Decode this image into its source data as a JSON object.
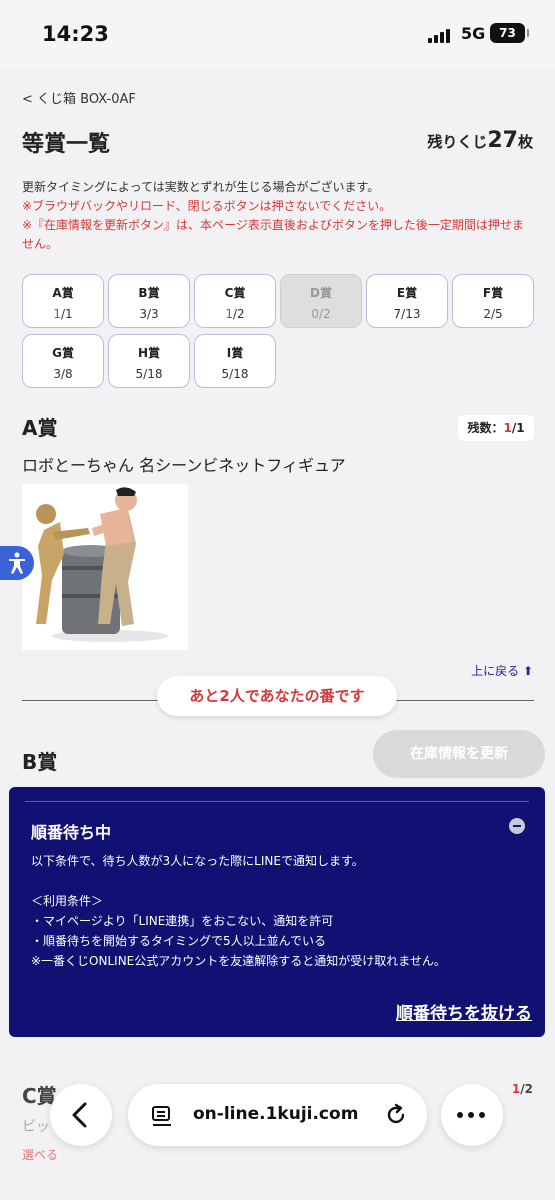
{
  "status": {
    "time": "14:23",
    "network": "5G",
    "battery": "73"
  },
  "breadcrumb": "くじ箱 BOX-0AF",
  "header": {
    "title": "等賞一覧",
    "remaining_label": "残りくじ",
    "remaining_count": "27",
    "remaining_unit": "枚"
  },
  "notes": {
    "line1": "更新タイミングによっては実数とずれが生じる場合がございます。",
    "line2": "※ブラウザバックやリロード、閉じるボタンは押さないでください。",
    "line3": "※『在庫情報を更新ボタン』は、本ページ表示直後およびボタンを押した後一定期間は押せません。"
  },
  "prizes": [
    {
      "name": "A賞",
      "left": "1",
      "total": "/1",
      "highlight": true,
      "disabled": false
    },
    {
      "name": "B賞",
      "left": "3",
      "total": "/3",
      "highlight": false,
      "disabled": false
    },
    {
      "name": "C賞",
      "left": "1",
      "total": "/2",
      "highlight": true,
      "disabled": false
    },
    {
      "name": "D賞",
      "left": "0",
      "total": "/2",
      "highlight": false,
      "disabled": true
    },
    {
      "name": "E賞",
      "left": "7",
      "total": "/13",
      "highlight": false,
      "disabled": false
    },
    {
      "name": "F賞",
      "left": "2",
      "total": "/5",
      "highlight": false,
      "disabled": false
    },
    {
      "name": "G賞",
      "left": "3",
      "total": "/8",
      "highlight": false,
      "disabled": false
    },
    {
      "name": "H賞",
      "left": "5",
      "total": "/18",
      "highlight": false,
      "disabled": false
    },
    {
      "name": "I賞",
      "left": "5",
      "total": "/18",
      "highlight": false,
      "disabled": false
    }
  ],
  "section_a": {
    "title": "A賞",
    "badge_label": "残数：",
    "badge_left": "1",
    "badge_total": "/1",
    "prize_name": "ロボとーちゃん 名シーンビネットフィギュア",
    "to_top": "上に戻る"
  },
  "turn_notice": "あと2人であなたの番です",
  "section_b": {
    "title": "B賞",
    "refresh_button": "在庫情報を更新"
  },
  "queue_panel": {
    "title": "順番待ち中",
    "line1": "以下条件で、待ち人数が3人になった際にLINEで通知します。",
    "line2": "＜利用条件＞",
    "line3": "・マイページより「LINE連携」をおこない、通知を許可",
    "line4": "・順番待ちを開始するタイミングで5人以上並んでいる",
    "line5": "※一番くじONLINE公式アカウントを友達解除すると通知が受け取れません。",
    "leave_link": "順番待ちを抜ける"
  },
  "section_c": {
    "title": "C賞",
    "name_fragment": "ビッ",
    "badge_left": "1",
    "badge_total": "/2",
    "select_label": "選べる"
  },
  "browser": {
    "url": "on-line.1kuji.com"
  },
  "colors": {
    "accent_red": "#d6383a",
    "navy": "#111173",
    "link_blue": "#1d2a84"
  }
}
